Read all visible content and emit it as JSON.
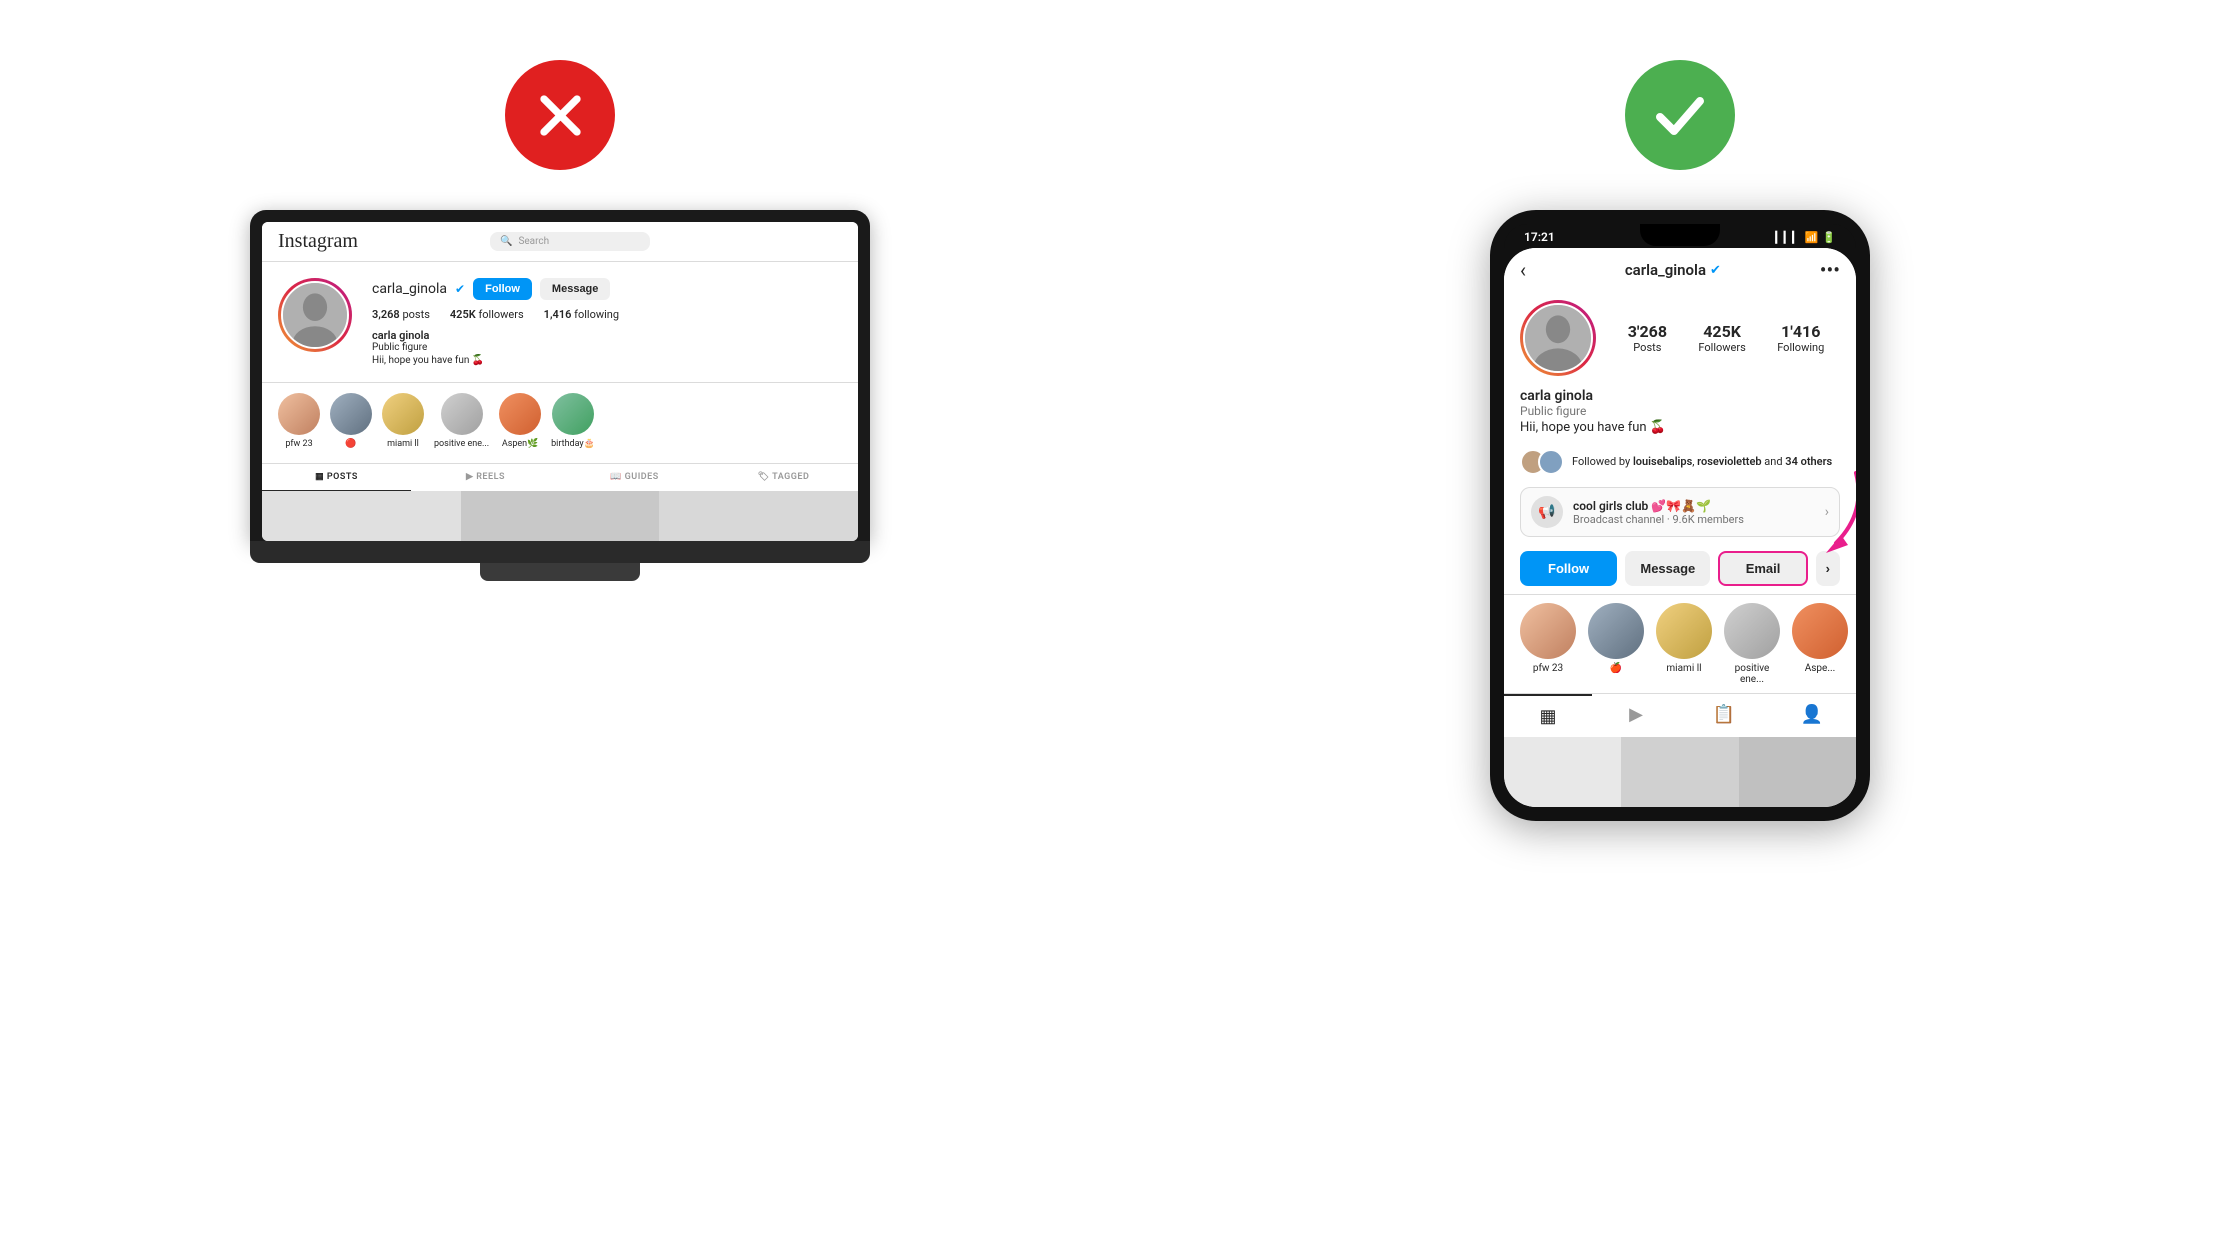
{
  "left": {
    "badge": "wrong",
    "laptop": {
      "header": {
        "logo": "Instagram",
        "search_placeholder": "Search"
      },
      "profile": {
        "username": "carla_ginola",
        "verified": true,
        "follow_btn": "Follow",
        "message_btn": "Message",
        "posts": "3,268",
        "posts_label": "posts",
        "followers": "425K",
        "followers_label": "followers",
        "following": "1,416",
        "following_label": "following",
        "name": "carla ginola",
        "category": "Public figure",
        "bio": "Hii, hope you have fun 🍒"
      },
      "highlights": [
        {
          "label": "pfw 23",
          "color": "hl-color-1"
        },
        {
          "label": "🔴",
          "color": "hl-color-2"
        },
        {
          "label": "miami ll",
          "color": "hl-color-3"
        },
        {
          "label": "positive ene...",
          "color": "hl-color-4"
        },
        {
          "label": "Aspen🌿",
          "color": "hl-color-5"
        },
        {
          "label": "birthday🎂",
          "color": "hl-color-6"
        }
      ],
      "tabs": [
        "POSTS",
        "REELS",
        "GUIDES",
        "TAGGED"
      ]
    }
  },
  "right": {
    "badge": "correct",
    "phone": {
      "status_bar": {
        "time": "17:21",
        "signal": "▎▎▎",
        "wifi": "wifi",
        "battery": "battery"
      },
      "header": {
        "back": "‹",
        "username": "carla_ginola",
        "verified": true,
        "more": "•••"
      },
      "profile": {
        "posts": "3'268",
        "posts_label": "Posts",
        "followers": "425K",
        "followers_label": "Followers",
        "following": "1'416",
        "following_label": "Following",
        "name": "carla ginola",
        "category": "Public figure",
        "bio": "Hii, hope you have fun 🍒"
      },
      "followed_by": {
        "text": "Followed by louisebalips, rosevioletteb and 34 others"
      },
      "channel": {
        "name": "cool girls club 💕🎀🧸🌱",
        "sub": "Broadcast channel · 9.6K members"
      },
      "actions": {
        "follow": "Follow",
        "message": "Message",
        "email": "Email",
        "more": "›"
      },
      "highlights": [
        {
          "label": "pfw 23",
          "color": "hl-color-1"
        },
        {
          "label": "🍎",
          "color": "hl-color-2"
        },
        {
          "label": "miami ll",
          "color": "hl-color-3"
        },
        {
          "label": "positive ene...",
          "color": "hl-color-4"
        },
        {
          "label": "Aspe...",
          "color": "hl-color-5"
        }
      ],
      "tabs": [
        "grid",
        "reels",
        "books",
        "person"
      ]
    }
  }
}
